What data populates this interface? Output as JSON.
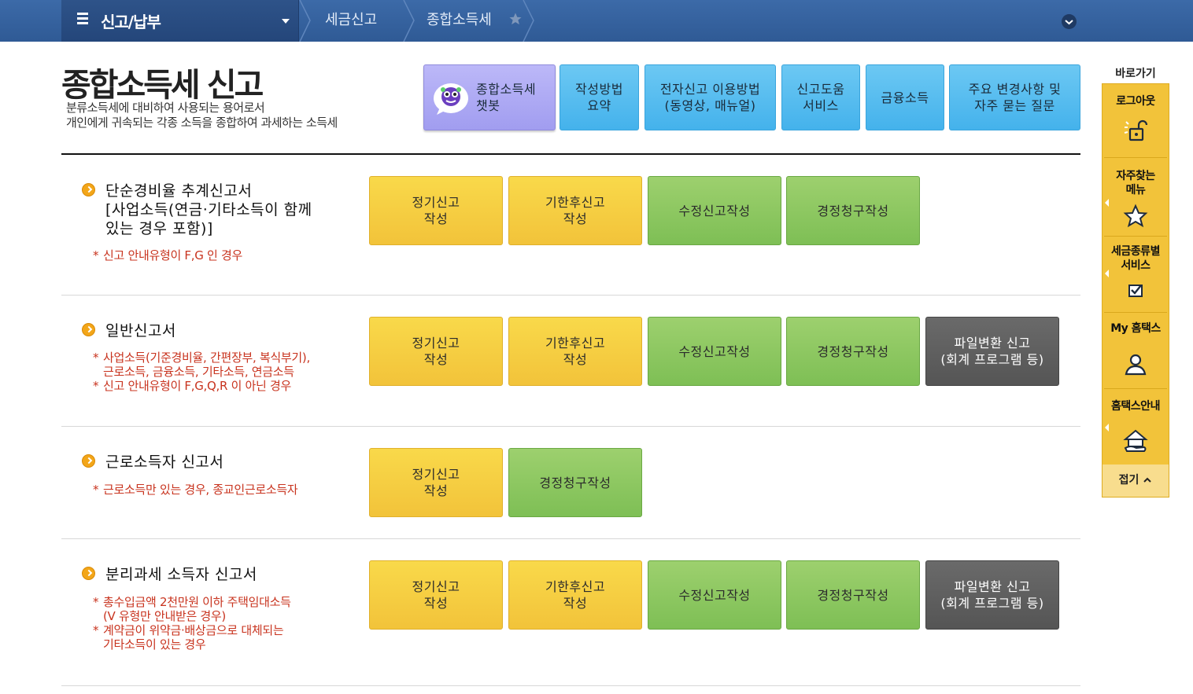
{
  "topbar": {
    "menu_title": "신고/납부",
    "crumbs": [
      "세금신고",
      "종합소득세"
    ]
  },
  "header": {
    "title": "종합소득세 신고",
    "desc": [
      "분류소득세에 대비하여 사용되는 용어로서",
      "개인에게 귀속되는 각종 소득을 종합하여 과세하는 소득세"
    ],
    "buttons": [
      {
        "lines": [
          "종합소득세",
          "챗봇"
        ]
      },
      {
        "lines": [
          "작성방법",
          "요약"
        ]
      },
      {
        "lines": [
          "전자신고 이용방법",
          "(동영상, 매뉴얼)"
        ]
      },
      {
        "lines": [
          "신고도움",
          "서비스"
        ]
      },
      {
        "lines": [
          "금융소득"
        ]
      },
      {
        "lines": [
          "주요 변경사항 및",
          "자주 묻는 질문"
        ]
      }
    ]
  },
  "sections": [
    {
      "title": [
        "단순경비율 추계신고서",
        "[사업소득(연금·기타소득이 함께",
        "있는 경우 포함)]"
      ],
      "notes": [
        {
          "text": "신고 안내유형이 F,G 인 경우",
          "star": true
        }
      ],
      "buttons": [
        [
          "정기신고",
          "작성"
        ],
        [
          "기한후신고",
          "작성"
        ],
        [
          "수정신고작성"
        ],
        [
          "경정청구작성"
        ]
      ]
    },
    {
      "title": [
        "일반신고서"
      ],
      "notes": [
        {
          "text": "사업소득(기준경비율, 간편장부, 복식부기),",
          "star": true
        },
        {
          "text": "근로소득, 금융소득, 기타소득, 연금소득",
          "star": false
        },
        {
          "text": "신고 안내유형이 F,G,Q,R 이 아닌 경우",
          "star": true
        }
      ],
      "buttons": [
        [
          "정기신고",
          "작성"
        ],
        [
          "기한후신고",
          "작성"
        ],
        [
          "수정신고작성"
        ],
        [
          "경정청구작성"
        ],
        [
          "파일변환 신고",
          "(회계 프로그램 등)"
        ]
      ]
    },
    {
      "title": [
        "근로소득자 신고서"
      ],
      "notes": [
        {
          "text": "근로소득만 있는 경우, 종교인근로소득자",
          "star": true
        }
      ],
      "buttons": [
        [
          "정기신고",
          "작성"
        ],
        [
          "경정청구작성"
        ]
      ]
    },
    {
      "title": [
        "분리과세 소득자 신고서"
      ],
      "notes": [
        {
          "text": "총수입금액 2천만원 이하 주택임대소득",
          "star": true
        },
        {
          "text": "(V 유형만 안내받은 경우)",
          "star": false
        },
        {
          "text": "계약금이 위약금·배상금으로 대체되는",
          "star": true
        },
        {
          "text": "기타소득이 있는 경우",
          "star": false
        }
      ],
      "buttons": [
        [
          "정기신고",
          "작성"
        ],
        [
          "기한후신고",
          "작성"
        ],
        [
          "수정신고작성"
        ],
        [
          "경정청구작성"
        ],
        [
          "파일변환 신고",
          "(회계 프로그램 등)"
        ]
      ]
    }
  ],
  "quick_menu": {
    "title": "바로가기",
    "items": [
      {
        "lines": [
          "로그아웃"
        ],
        "icon": "unlock-icon"
      },
      {
        "lines": [
          "자주찾는",
          "메뉴"
        ],
        "icon": "star-icon"
      },
      {
        "lines": [
          "세금종류별",
          "서비스"
        ],
        "icon": "checkbox-icon"
      },
      {
        "lines": [
          "My 홈택스"
        ],
        "icon": "user-icon"
      },
      {
        "lines": [
          "홈택스안내"
        ],
        "icon": "home-hand-icon"
      }
    ],
    "fold_label": "접기"
  },
  "colors": {
    "topbar": "#3263a0",
    "yellow": "#f2c33a",
    "green": "#86c45c",
    "gray": "#5e5e5e",
    "sky": "#55bbef",
    "chatbot": "#aaa6f3",
    "note_red": "#c8331e"
  }
}
